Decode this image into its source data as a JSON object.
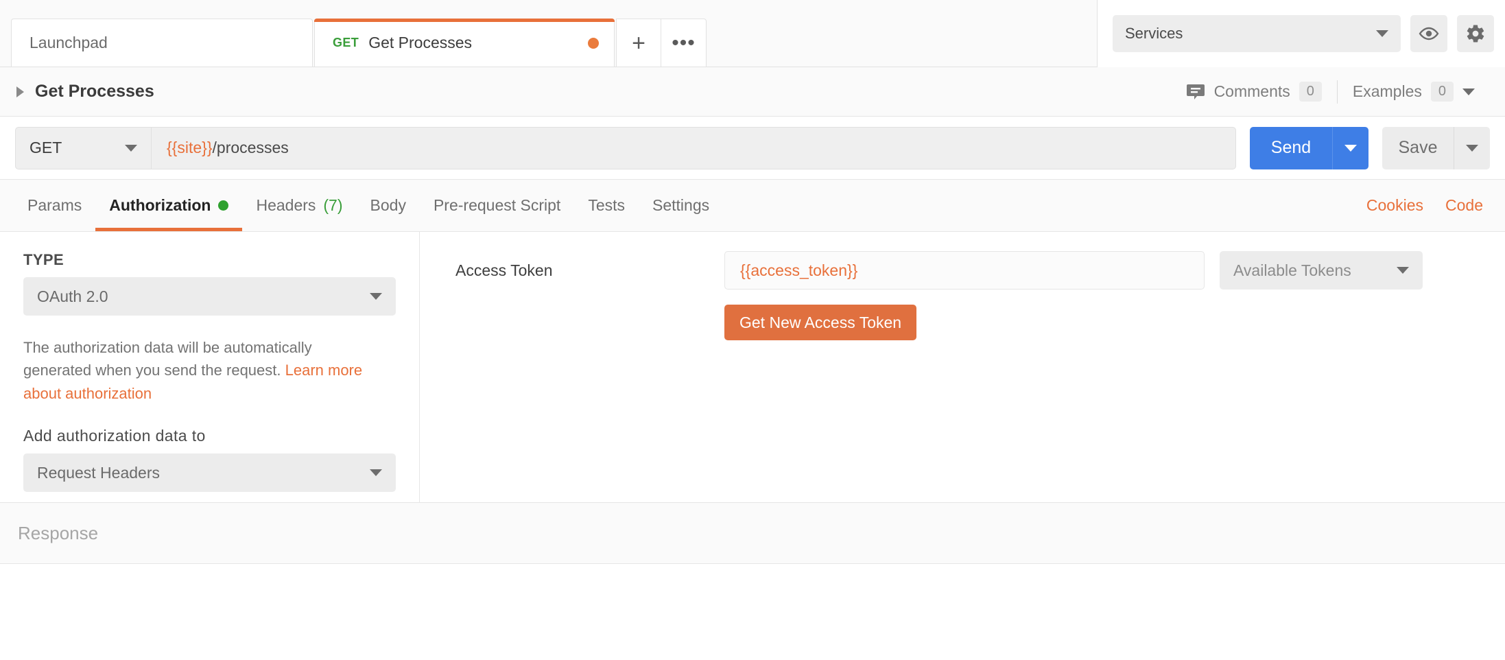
{
  "tabstrip": {
    "tabs": [
      {
        "label": "Launchpad",
        "method": "",
        "active": false,
        "unsaved": false
      },
      {
        "label": "Get Processes",
        "method": "GET",
        "active": true,
        "unsaved": true
      }
    ],
    "new_tab_label": "+",
    "more_tabs_label": "•••",
    "environment": {
      "value": "Services"
    },
    "eye_button": "environment-quick-look",
    "gear_button": "settings"
  },
  "breadcrumb": {
    "title": "Get Processes",
    "comments": {
      "label": "Comments",
      "count": "0"
    },
    "examples": {
      "label": "Examples",
      "count": "0"
    }
  },
  "url_row": {
    "method": "GET",
    "url_variable": "{{site}}",
    "url_path": "/processes",
    "send_label": "Send",
    "save_label": "Save"
  },
  "request_tabs": {
    "items": [
      {
        "label": "Params",
        "active": false,
        "dot": false,
        "count": ""
      },
      {
        "label": "Authorization",
        "active": true,
        "dot": true,
        "count": ""
      },
      {
        "label": "Headers",
        "active": false,
        "dot": false,
        "count": "(7)"
      },
      {
        "label": "Body",
        "active": false,
        "dot": false,
        "count": ""
      },
      {
        "label": "Pre-request Script",
        "active": false,
        "dot": false,
        "count": ""
      },
      {
        "label": "Tests",
        "active": false,
        "dot": false,
        "count": ""
      },
      {
        "label": "Settings",
        "active": false,
        "dot": false,
        "count": ""
      }
    ],
    "cookies_label": "Cookies",
    "code_label": "Code"
  },
  "authorization": {
    "type_label": "TYPE",
    "type_value": "OAuth 2.0",
    "help_text": "The authorization data will be automatically generated when you send the request. ",
    "help_link": "Learn more about authorization",
    "add_data_label": "Add authorization data to",
    "add_data_value": "Request Headers",
    "access_token_label": "Access Token",
    "access_token_value": "{{access_token}}",
    "available_tokens_label": "Available Tokens",
    "get_new_token_label": "Get New Access Token"
  },
  "response": {
    "label": "Response"
  },
  "colors": {
    "accent_orange": "#e8703a",
    "send_blue": "#3e7ee6",
    "method_green": "#3a9e3a",
    "button_orange": "#e0703f"
  }
}
